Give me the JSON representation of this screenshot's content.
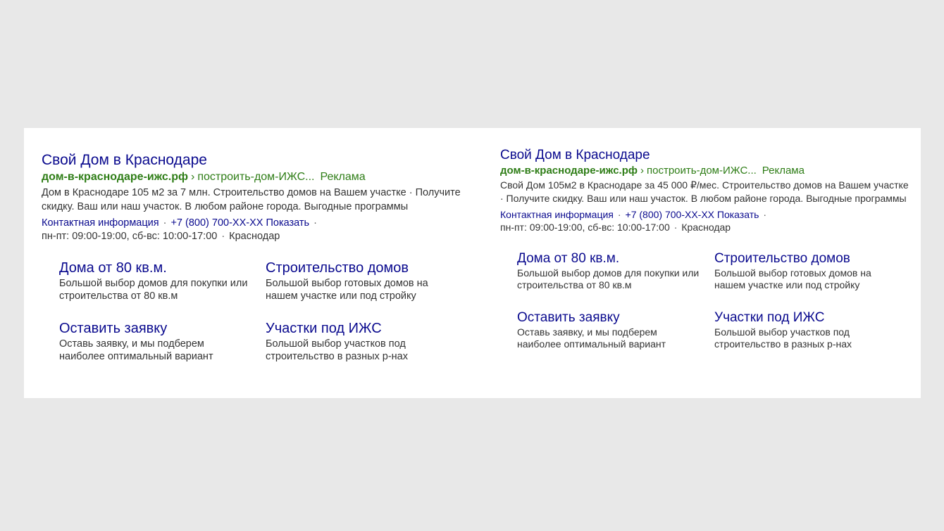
{
  "ads": [
    {
      "title": "Свой Дом в Краснодаре",
      "domain": "дом-в-краснодаре-ижс.рф",
      "path": "построить-дом-ИЖС...",
      "ad_label": "Реклама",
      "description": "Дом в Краснодаре 105 м2 за 7 млн. Строительство домов на Вашем участке · Получите скидку. Ваш или наш участок. В любом районе города. Выгодные программы",
      "contact_label": "Контактная информация",
      "phone": "+7 (800) 700-XX-XX Показать",
      "hours": "пн-пт: 09:00-19:00, сб-вс: 10:00-17:00",
      "city": "Краснодар",
      "sitelinks": [
        {
          "title": "Дома от 80 кв.м.",
          "desc": "Большой выбор домов для покупки или строительства от 80 кв.м"
        },
        {
          "title": "Строительство домов",
          "desc": "Большой выбор готовых домов на нашем участке или под стройку"
        },
        {
          "title": "Оставить заявку",
          "desc": "Оставь заявку, и мы подберем наиболее оптимальный вариант"
        },
        {
          "title": "Участки под ИЖС",
          "desc": "Большой выбор участков под строительство в разных р-нах"
        }
      ]
    },
    {
      "title": "Свой Дом в Краснодаре",
      "domain": "дом-в-краснодаре-ижс.рф",
      "path": "построить-дом-ИЖС...",
      "ad_label": "Реклама",
      "description": "Свой Дом 105м2 в Краснодаре за 45 000 ₽/мес. Строительство домов на Вашем участке · Получите скидку. Ваш или наш участок. В любом районе города. Выгодные программы",
      "contact_label": "Контактная информация",
      "phone": "+7 (800) 700-XX-XX Показать",
      "hours": "пн-пт: 09:00-19:00, сб-вс: 10:00-17:00",
      "city": "Краснодар",
      "sitelinks": [
        {
          "title": "Дома от 80 кв.м.",
          "desc": "Большой выбор домов для покупки или строительства от 80 кв.м"
        },
        {
          "title": "Строительство домов",
          "desc": "Большой выбор готовых домов на нашем участке или под стройку"
        },
        {
          "title": "Оставить заявку",
          "desc": "Оставь заявку, и мы подберем наиболее оптимальный вариант"
        },
        {
          "title": "Участки под ИЖС",
          "desc": "Большой выбор участков под строительство в разных р-нах"
        }
      ]
    }
  ],
  "colors": {
    "link": "#0a0a8e",
    "url_green": "#2e7d16",
    "text": "#333333",
    "page_bg": "#e8e8e8",
    "panel_bg": "#ffffff"
  }
}
